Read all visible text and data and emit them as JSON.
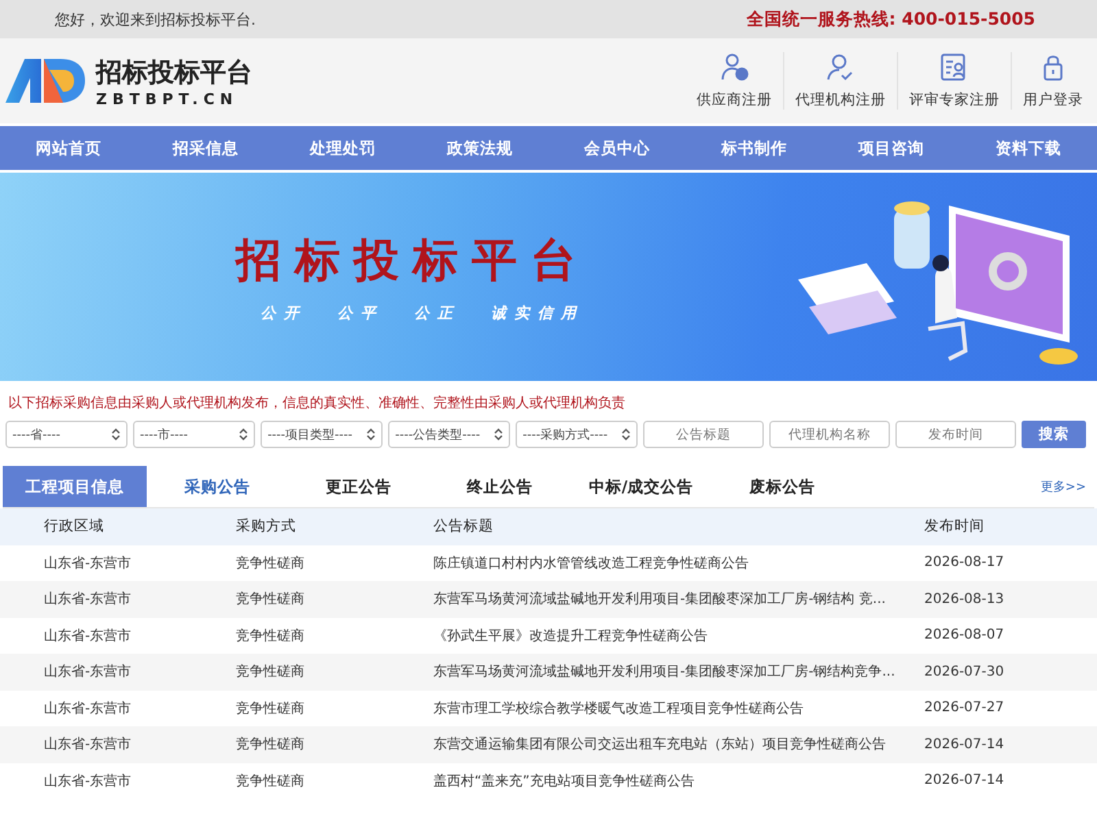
{
  "top_bar": {
    "welcome": "您好，欢迎来到招标投标平台.",
    "hotline": "全国统一服务热线: 400-015-5005"
  },
  "logo": {
    "title": "招标投标平台",
    "domain": "ZBTBPT.CN"
  },
  "header_links": [
    {
      "kind": "supplier",
      "label": "供应商注册"
    },
    {
      "kind": "agency",
      "label": "代理机构注册"
    },
    {
      "kind": "expert",
      "label": "评审专家注册"
    },
    {
      "kind": "login",
      "label": "用户登录"
    }
  ],
  "nav": [
    "网站首页",
    "招采信息",
    "处理处罚",
    "政策法规",
    "会员中心",
    "标书制作",
    "项目咨询",
    "资料下载"
  ],
  "banner": {
    "title": "招标投标平台",
    "slogan": [
      "公开",
      "公平",
      "公正",
      "诚实信用"
    ]
  },
  "notice": "以下招标采购信息由采购人或代理机构发布，信息的真实性、准确性、完整性由采购人或代理机构负责",
  "filters": [
    {
      "kind": "select",
      "value": "----省----"
    },
    {
      "kind": "select",
      "value": "----市----"
    },
    {
      "kind": "select",
      "value": "----项目类型----"
    },
    {
      "kind": "select",
      "value": "----公告类型----"
    },
    {
      "kind": "select",
      "value": "----采购方式----"
    },
    {
      "kind": "input",
      "placeholder": "公告标题"
    },
    {
      "kind": "input",
      "placeholder": "代理机构名称"
    },
    {
      "kind": "input",
      "placeholder": "发布时间"
    }
  ],
  "search_button": "搜索",
  "section_title": "工程项目信息",
  "tabs": [
    {
      "label": "采购公告",
      "selected": true
    },
    {
      "label": "更正公告",
      "selected": false
    },
    {
      "label": "终止公告",
      "selected": false
    },
    {
      "label": "中标/成交公告",
      "selected": false
    },
    {
      "label": "废标公告",
      "selected": false
    }
  ],
  "more_link": "更多>>",
  "table": {
    "columns": [
      "行政区域",
      "采购方式",
      "公告标题",
      "发布时间"
    ],
    "rows": [
      [
        "山东省-东营市",
        "竞争性磋商",
        "陈庄镇道口村村内水管管线改造工程竞争性磋商公告",
        "2026-08-17"
      ],
      [
        "山东省-东营市",
        "竞争性磋商",
        "东营军马场黄河流域盐碱地开发利用项目-集团酸枣深加工厂房-钢结构 竞...",
        "2026-08-13"
      ],
      [
        "山东省-东营市",
        "竞争性磋商",
        "《孙武生平展》改造提升工程竞争性磋商公告",
        "2026-08-07"
      ],
      [
        "山东省-东营市",
        "竞争性磋商",
        "东营军马场黄河流域盐碱地开发利用项目-集团酸枣深加工厂房-钢结构竞争...",
        "2026-07-30"
      ],
      [
        "山东省-东营市",
        "竞争性磋商",
        "东营市理工学校综合教学楼暖气改造工程项目竞争性磋商公告",
        "2026-07-27"
      ],
      [
        "山东省-东营市",
        "竞争性磋商",
        "东营交通运输集团有限公司交运出租车充电站（东站）项目竞争性磋商公告",
        "2026-07-14"
      ],
      [
        "山东省-东营市",
        "竞争性磋商",
        "盖西村“盖来充”充电站项目竞争性磋商公告",
        "2026-07-14"
      ]
    ]
  }
}
